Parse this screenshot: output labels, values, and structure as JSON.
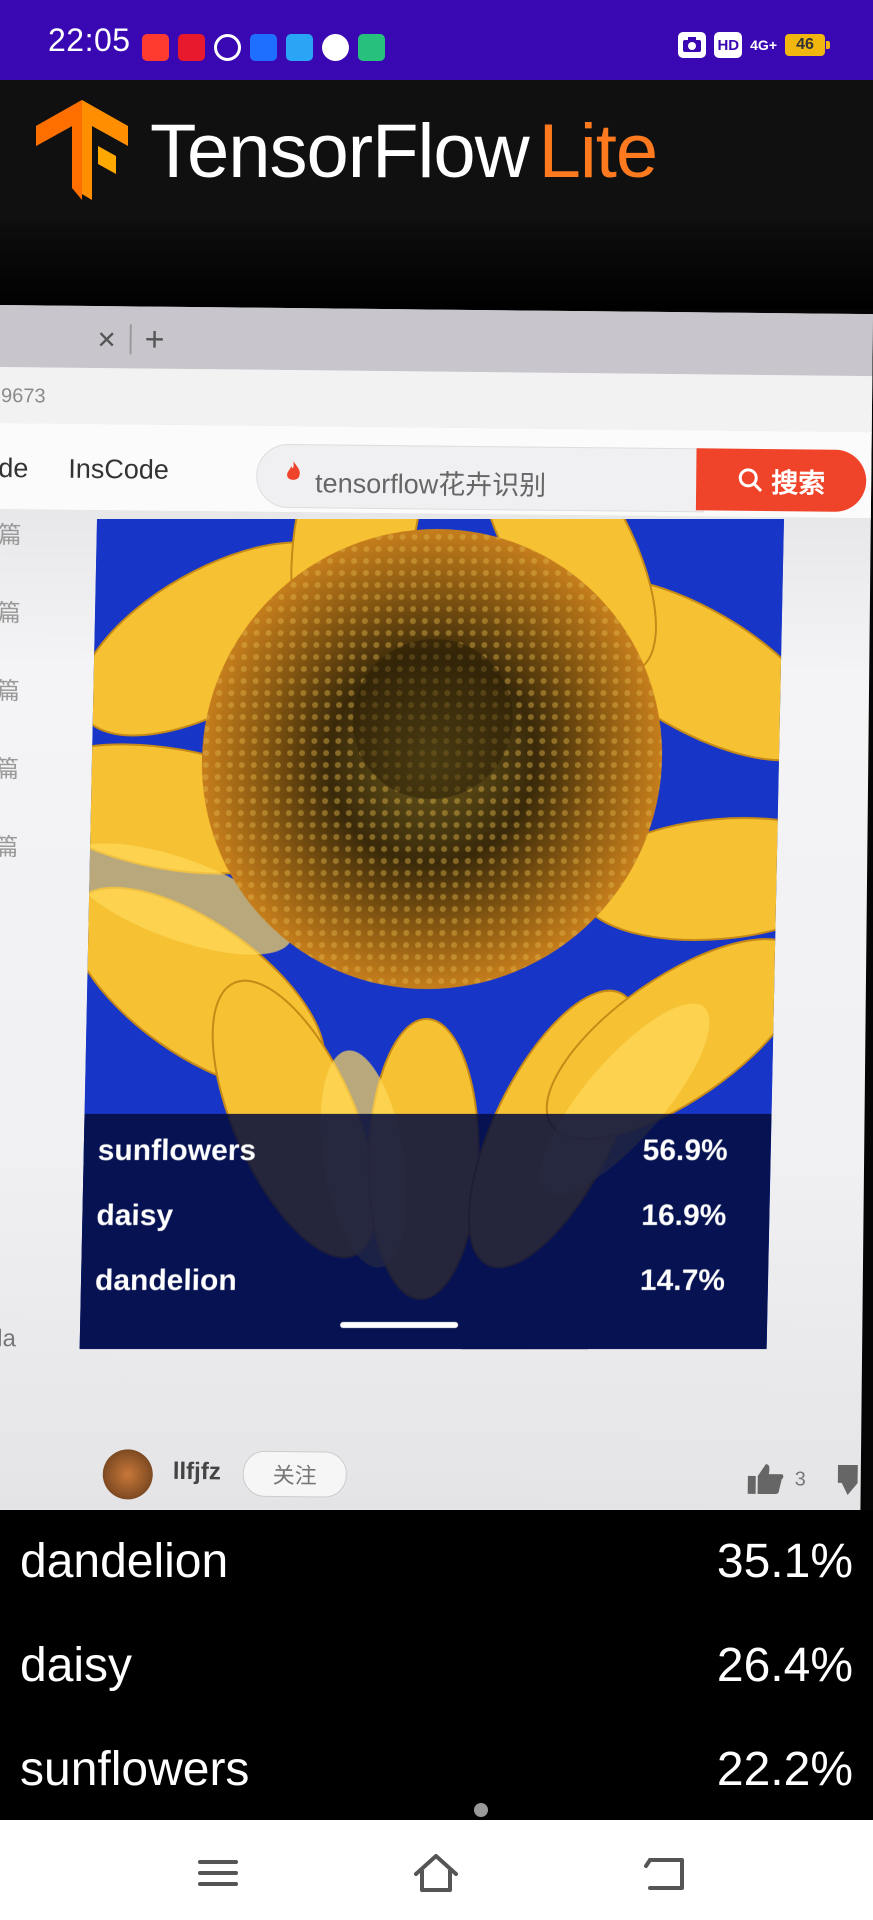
{
  "status_bar": {
    "time": "22:05",
    "notification_icons": [
      {
        "name": "taobao-app-icon",
        "color": "#ff3b30"
      },
      {
        "name": "gift-app-icon",
        "color": "#e8192c"
      },
      {
        "name": "cat-app-icon",
        "color": "#ffffff"
      },
      {
        "name": "zhihu-app-icon",
        "color": "#1f6fff"
      },
      {
        "name": "search-app-icon",
        "color": "#2aa4f4"
      },
      {
        "name": "compass-app-icon",
        "color": "#ffffff"
      },
      {
        "name": "notes-app-icon",
        "color": "#27c07d"
      }
    ],
    "hd_label": "HD",
    "network_label": "4G+",
    "battery_level": "46"
  },
  "app_bar": {
    "brand_main": "TensorFlow",
    "brand_accent": "Lite",
    "accent_color": "#ff7a1f"
  },
  "camera_view": {
    "url_fragment": "9673",
    "nav_code": "de",
    "nav_inscode": "InsCode",
    "search_query": "tensorflow花卉识别",
    "search_button": "搜索",
    "sidebar_chars": [
      "篇",
      "篇",
      "篇",
      "篇",
      "篇"
    ],
    "left_text": "da",
    "author_name": "llfjfz",
    "follow_label": "关注",
    "like_count": "3",
    "inner_results": [
      {
        "label": "sunflowers",
        "value": "56.9%"
      },
      {
        "label": "daisy",
        "value": "16.9%"
      },
      {
        "label": "dandelion",
        "value": "14.7%"
      }
    ]
  },
  "results": [
    {
      "label": "dandelion",
      "value": "35.1%"
    },
    {
      "label": "daisy",
      "value": "26.4%"
    },
    {
      "label": "sunflowers",
      "value": "22.2%"
    }
  ],
  "nav_bar": {
    "buttons": [
      "menu",
      "home",
      "back"
    ]
  }
}
